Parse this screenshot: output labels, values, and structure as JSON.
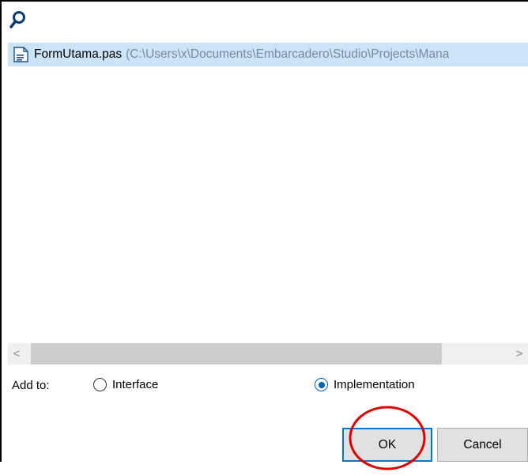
{
  "window": {
    "search_icon": "search-icon"
  },
  "file_list": {
    "items": [
      {
        "icon": "pascal-file-icon",
        "name": "FormUtama.pas",
        "path": "(C:\\Users\\x\\Documents\\Embarcadero\\Studio\\Projects\\Mana"
      }
    ]
  },
  "scrollbar": {
    "left_arrow": "<",
    "right_arrow": ">"
  },
  "add_to": {
    "label": "Add to:",
    "options": [
      {
        "label": "Interface",
        "selected": false
      },
      {
        "label": "Implementation",
        "selected": true
      }
    ]
  },
  "buttons": {
    "ok_label": "OK",
    "cancel_label": "Cancel"
  },
  "colors": {
    "selection": "#cce4f7",
    "accent": "#0078d7",
    "annotation": "#e00000"
  }
}
